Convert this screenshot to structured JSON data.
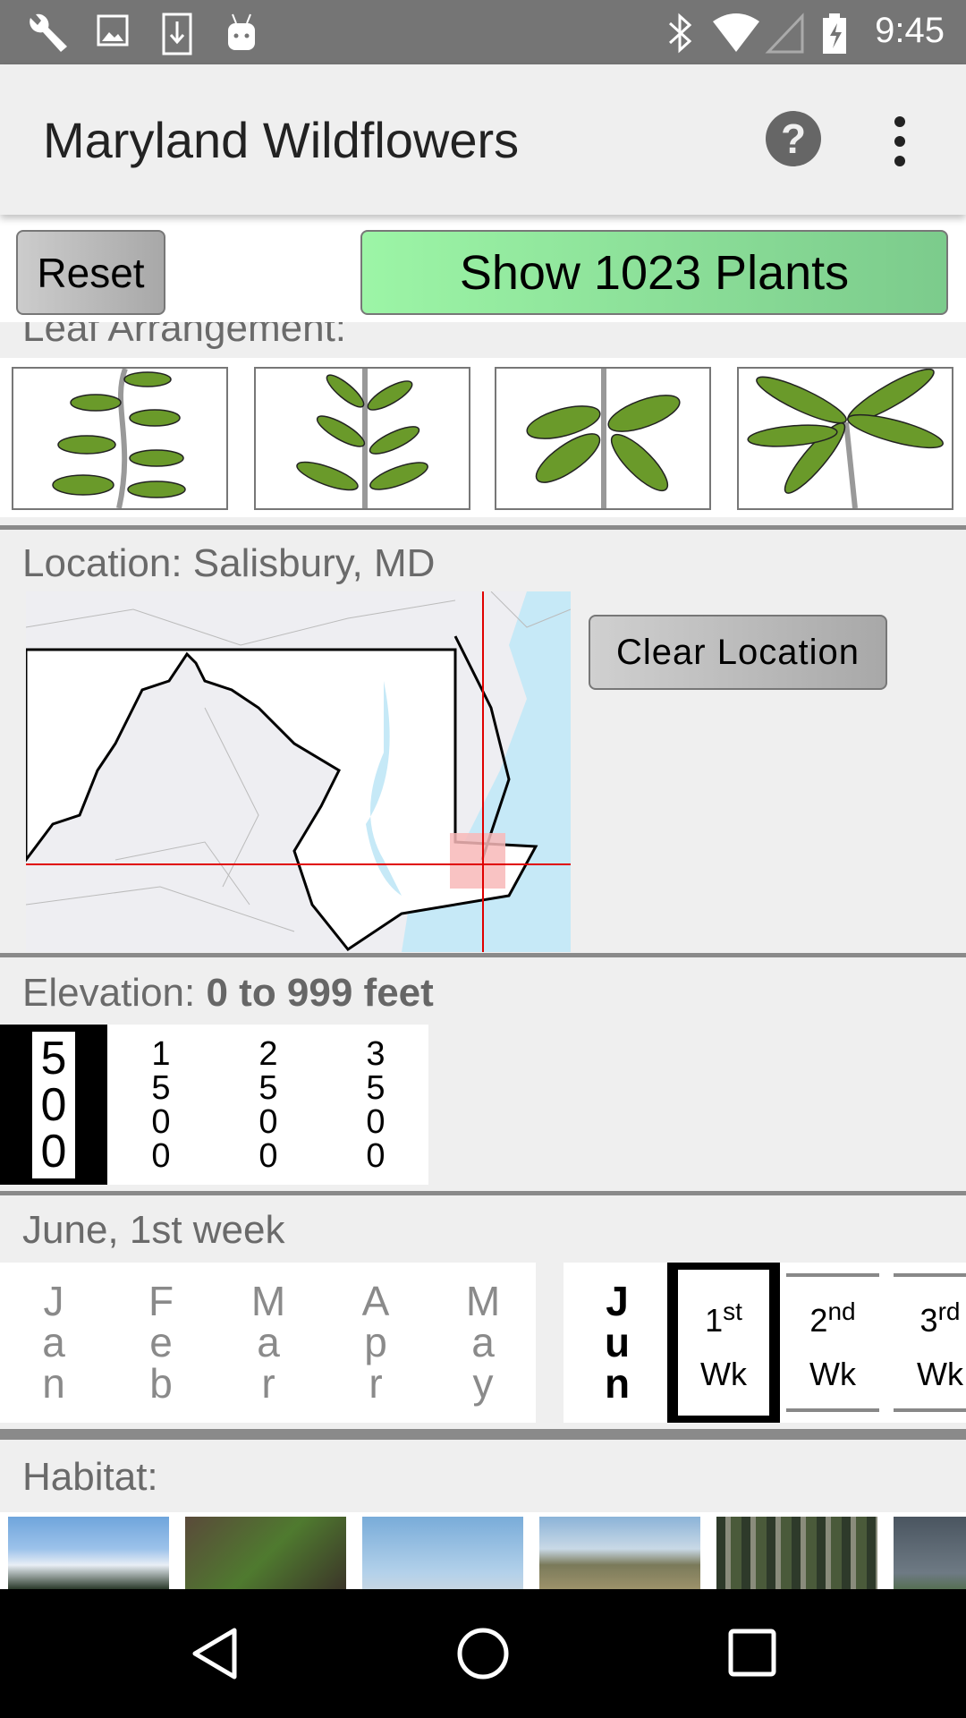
{
  "status_bar": {
    "time": "9:45",
    "left_icons": [
      "wrench-icon",
      "image-icon",
      "download-icon",
      "android-icon"
    ],
    "right_icons": [
      "bluetooth-icon",
      "wifi-icon",
      "cell-signal-icon",
      "battery-charging-icon"
    ]
  },
  "app_bar": {
    "title": "Maryland Wildflowers",
    "help_icon": "help-circle-icon",
    "more_icon": "more-vert-icon"
  },
  "actions": {
    "reset_label": "Reset",
    "show_label": "Show 1023 Plants"
  },
  "leaf": {
    "label": "Leaf Arrangement:",
    "options": [
      "alternate",
      "alternate-sparse",
      "opposite",
      "whorled"
    ]
  },
  "location": {
    "label": "Location: Salisbury, MD",
    "clear_label": "Clear Location"
  },
  "elevation": {
    "label": "Elevation: ",
    "value": "0 to 999 feet",
    "options": [
      {
        "digits": [
          "5",
          "0",
          "0"
        ],
        "selected": true
      },
      {
        "digits": [
          "1",
          "5",
          "0",
          "0"
        ],
        "selected": false
      },
      {
        "digits": [
          "2",
          "5",
          "0",
          "0"
        ],
        "selected": false
      },
      {
        "digits": [
          "3",
          "5",
          "0",
          "0"
        ],
        "selected": false
      }
    ]
  },
  "season": {
    "label": "June, 1st week",
    "months": [
      [
        "J",
        "a",
        "n"
      ],
      [
        "F",
        "e",
        "b"
      ],
      [
        "M",
        "a",
        "r"
      ],
      [
        "A",
        "p",
        "r"
      ],
      [
        "M",
        "a",
        "y"
      ]
    ],
    "current_month": [
      "J",
      "u",
      "n"
    ],
    "weeks": [
      {
        "num": "1",
        "sup": "st",
        "wk": "Wk",
        "selected": true
      },
      {
        "num": "2",
        "sup": "nd",
        "wk": "Wk",
        "selected": false
      },
      {
        "num": "3",
        "sup": "rd",
        "wk": "Wk",
        "selected": false
      }
    ]
  },
  "habitat": {
    "label": "Habitat:",
    "images": [
      "mountains",
      "rock-ferns",
      "open-water",
      "grassland",
      "forest",
      "storm-field"
    ]
  },
  "colors": {
    "show_button": "#8fe29d",
    "selection": "#000000",
    "map_crosshair": "#e00000",
    "water": "#c6e9f7"
  }
}
